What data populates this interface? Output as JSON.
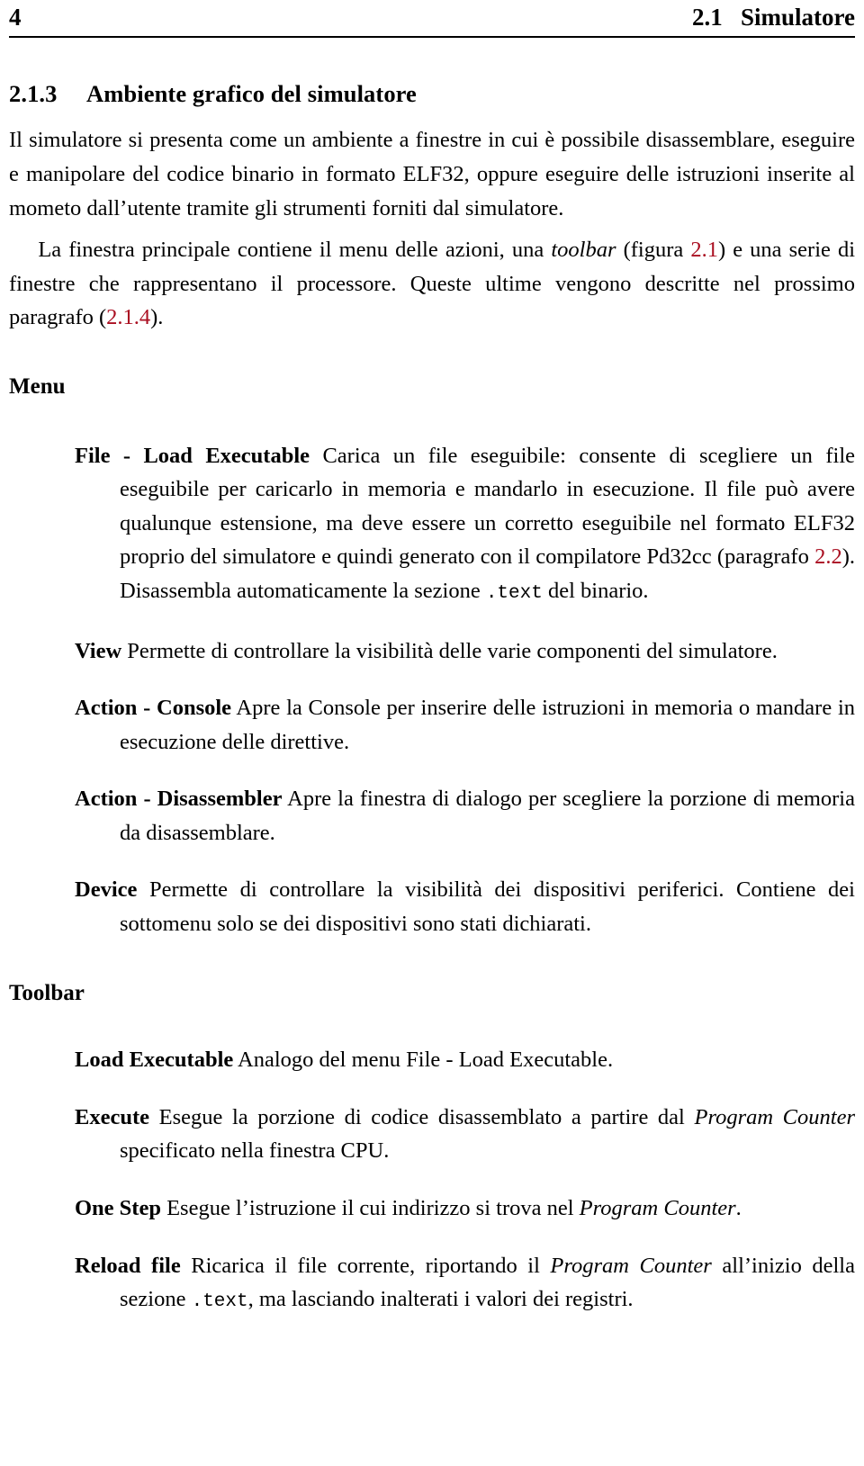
{
  "running_head": {
    "folio": "4",
    "title": "2.1   Simulatore"
  },
  "section": {
    "number": "2.1.3",
    "title": "Ambiente grafico del simulatore"
  },
  "intro": {
    "p1_a": "Il simulatore si presenta come un ambiente a finestre in cui è possibile disassemblare, eseguire e manipolare del codice binario in formato ELF32, oppure eseguire delle istruzioni inserite al mometo dall’utente tramite gli strumenti forniti dal simulatore.",
    "p2_a": "La finestra principale contiene il menu delle azioni, una ",
    "p2_toolbar": "toolbar",
    "p2_b": " (figura ",
    "p2_ref1": "2.1",
    "p2_c": ") e una serie di finestre che rappresentano il processore. Queste ultime vengono descritte nel prossimo paragrafo (",
    "p2_ref2": "2.1.4",
    "p2_d": ")."
  },
  "menu": {
    "heading": "Menu",
    "items": [
      {
        "term": "File - Load Executable",
        "body_a": " Carica un file eseguibile: consente di scegliere un file eseguibile per caricarlo in memoria e mandarlo in esecuzione. Il file può avere qualunque estensione, ma deve essere un corretto eseguibile nel formato ELF32 proprio del simulatore e quindi generato con il compilatore Pd32cc (paragrafo ",
        "ref": "2.2",
        "body_b": "). Disassembla automaticamente la sezione ",
        "code": ".text",
        "body_c": " del binario."
      },
      {
        "term": "View",
        "body_a": " Permette di controllare la visibilità delle varie componenti del simulatore."
      },
      {
        "term": "Action - Console",
        "body_a": " Apre la Console per inserire delle istruzioni in memoria o mandare in esecuzione delle direttive."
      },
      {
        "term": "Action - Disassembler",
        "body_a": " Apre la finestra di dialogo per scegliere la porzione di memoria da disassemblare."
      },
      {
        "term": "Device",
        "body_a": " Permette di controllare la visibilità dei dispositivi periferici. Contiene dei sottomenu solo se dei dispositivi sono stati dichiarati."
      }
    ]
  },
  "toolbar": {
    "heading": "Toolbar",
    "items": [
      {
        "term": "Load Executable",
        "body_a": " Analogo del menu File - Load Executable."
      },
      {
        "term": "Execute",
        "body_a": " Esegue la porzione di codice disassemblato a partire dal ",
        "italic": "Program Counter",
        "body_b": " specificato nella finestra CPU."
      },
      {
        "term": "One Step",
        "body_a": " Esegue l’istruzione il cui indirizzo si trova nel ",
        "italic": "Program Counter",
        "body_b": "."
      },
      {
        "term": "Reload file",
        "body_a": " Ricarica il file corrente, riportando il ",
        "italic": "Program Counter",
        "body_b": " all’inizio della sezione ",
        "code": ".text",
        "body_c": ", ma lasciando inalterati i valori dei registri."
      }
    ]
  },
  "colors": {
    "link": "#AA0F21",
    "text": "#000000",
    "page": "#FFFFFF"
  }
}
